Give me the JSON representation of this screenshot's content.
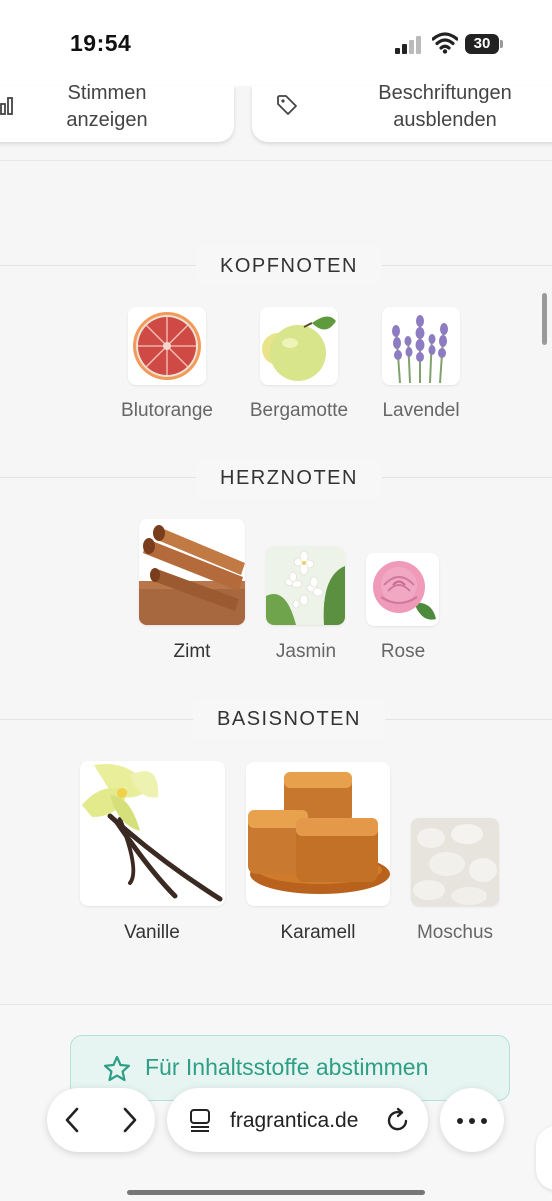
{
  "status": {
    "time": "19:54",
    "battery": "30"
  },
  "top_buttons": {
    "votes_line1": "Stimmen",
    "votes_line2": "anzeigen",
    "labels_line1": "Beschriftungen",
    "labels_line2": "ausblenden"
  },
  "pyramid": {
    "top": {
      "heading": "KOPFNOTEN",
      "notes": [
        "Blutorange",
        "Bergamotte",
        "Lavendel"
      ]
    },
    "heart": {
      "heading": "HERZNOTEN",
      "notes": [
        "Zimt",
        "Jasmin",
        "Rose"
      ]
    },
    "base": {
      "heading": "BASISNOTEN",
      "notes": [
        "Vanille",
        "Karamell",
        "Moschus"
      ]
    }
  },
  "vote_button": {
    "label": "Für Inhaltsstoffe abstimmen"
  },
  "browser": {
    "url": "fragrantica.de"
  },
  "colors": {
    "accent": "#2f9e86",
    "accent_bg": "#e6f5f1"
  }
}
